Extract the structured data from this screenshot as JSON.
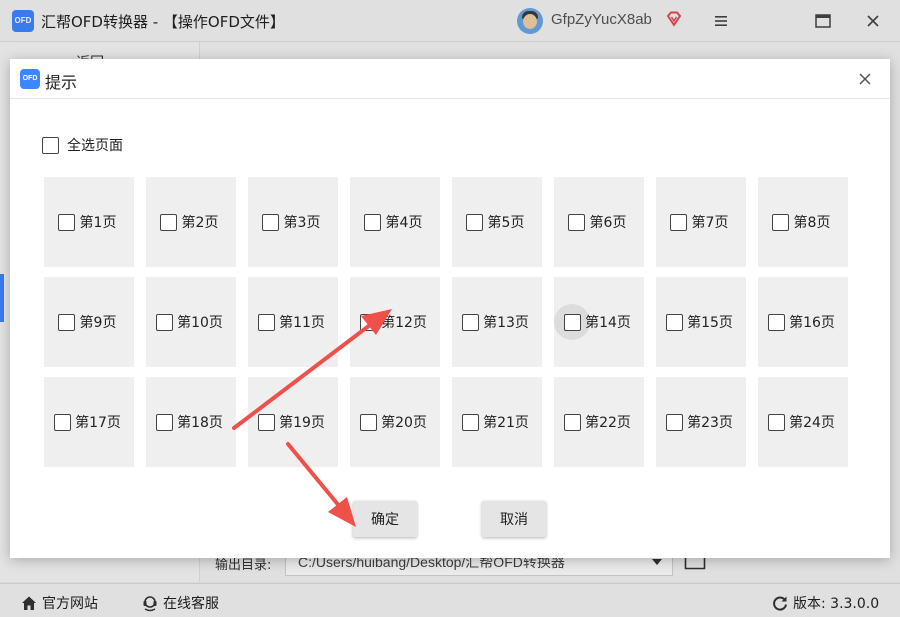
{
  "app": {
    "logo_text": "OFD",
    "title": "汇帮OFD转换器 - 【操作OFD文件】",
    "username": "GfpZyYucX8ab",
    "back_label": "← 返回"
  },
  "output": {
    "label": "输出目录:",
    "path": "C:/Users/huibang/Desktop/汇帮OFD转换器"
  },
  "status": {
    "website": "官方网站",
    "service": "在线客服",
    "version": "版本: 3.3.0.0"
  },
  "dialog": {
    "logo_text": "OFD",
    "title": "提示",
    "select_all": "全选页面",
    "pages": [
      "第1页",
      "第2页",
      "第3页",
      "第4页",
      "第5页",
      "第6页",
      "第7页",
      "第8页",
      "第9页",
      "第10页",
      "第11页",
      "第12页",
      "第13页",
      "第14页",
      "第15页",
      "第16页",
      "第17页",
      "第18页",
      "第19页",
      "第20页",
      "第21页",
      "第22页",
      "第23页",
      "第24页"
    ],
    "hovered_page": "第14页",
    "ok": "确定",
    "cancel": "取消"
  },
  "colors": {
    "accent": "#3d86ff",
    "arrow": "#f0504a",
    "tile": "#efefef"
  }
}
